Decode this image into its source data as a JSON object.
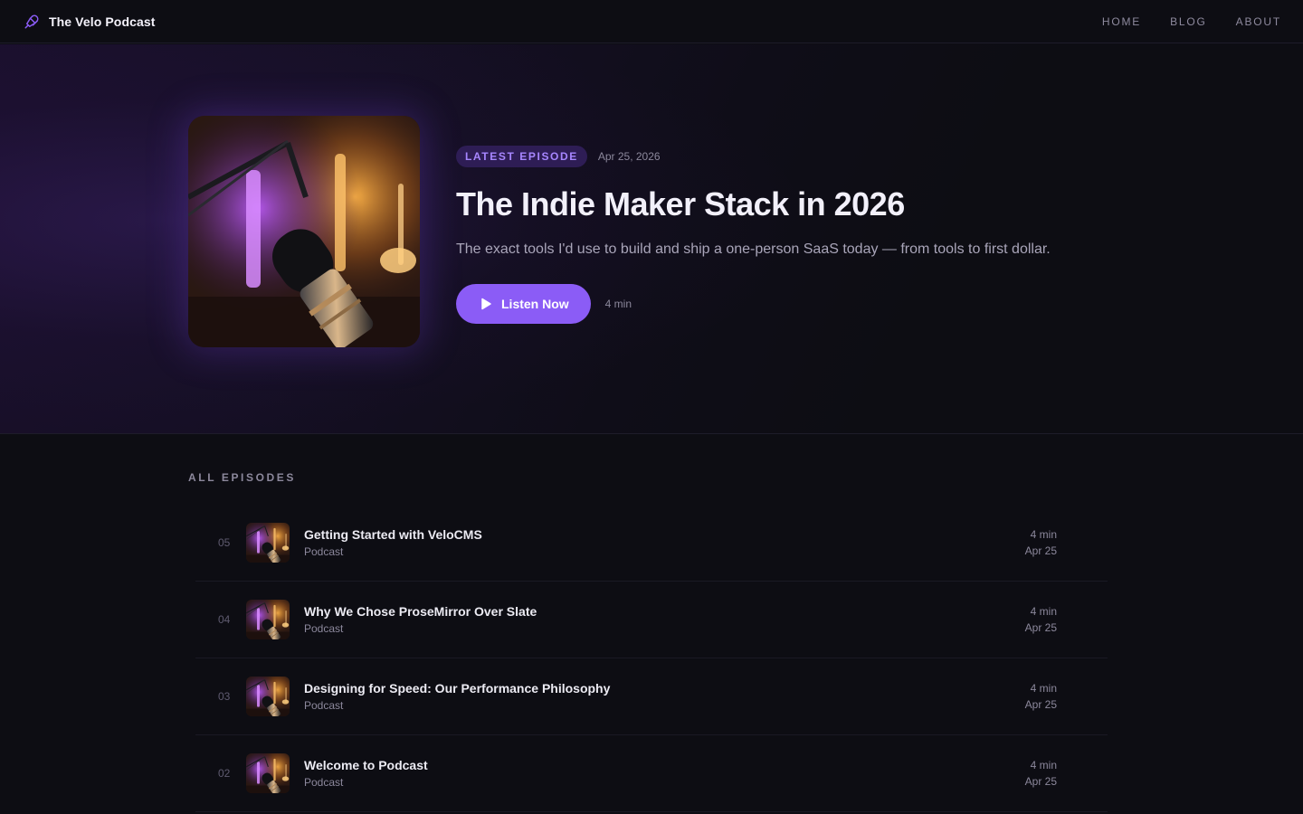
{
  "header": {
    "brand_name": "The Velo Podcast",
    "nav": [
      {
        "label": "HOME"
      },
      {
        "label": "BLOG"
      },
      {
        "label": "ABOUT"
      }
    ]
  },
  "hero": {
    "badge": "LATEST EPISODE",
    "date": "Apr 25, 2026",
    "title": "The Indie Maker Stack in 2026",
    "description": "The exact tools I'd use to build and ship a one-person SaaS today — from tools to first dollar.",
    "listen_label": "Listen Now",
    "duration": "4 min"
  },
  "episodes": {
    "section_label": "ALL EPISODES",
    "items": [
      {
        "number": "05",
        "title": "Getting Started with VeloCMS",
        "category": "Podcast",
        "duration": "4 min",
        "date": "Apr 25"
      },
      {
        "number": "04",
        "title": "Why We Chose ProseMirror Over Slate",
        "category": "Podcast",
        "duration": "4 min",
        "date": "Apr 25"
      },
      {
        "number": "03",
        "title": "Designing for Speed: Our Performance Philosophy",
        "category": "Podcast",
        "duration": "4 min",
        "date": "Apr 25"
      },
      {
        "number": "02",
        "title": "Welcome to Podcast",
        "category": "Podcast",
        "duration": "4 min",
        "date": "Apr 25"
      }
    ]
  },
  "colors": {
    "accent": "#8b5cf6",
    "badge_bg": "#2e1d55",
    "badge_text": "#a786ff",
    "background": "#0d0d13"
  }
}
